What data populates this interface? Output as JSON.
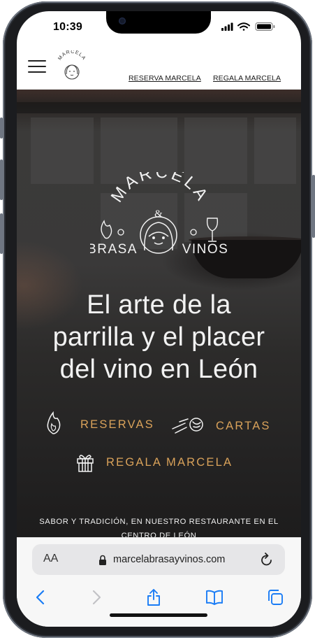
{
  "status_bar": {
    "time": "10:39",
    "signal_icon": "cellular-signal-icon",
    "wifi_icon": "wifi-icon",
    "battery_icon": "battery-icon"
  },
  "header": {
    "menu_icon": "hamburger-menu-icon",
    "logo_text": "MARCELA",
    "nav": [
      {
        "label": "RESERVA MARCELA"
      },
      {
        "label": "REGALA MARCELA"
      }
    ]
  },
  "hero": {
    "logo": {
      "name": "MARCELA",
      "ampersand": "&",
      "left": "BRASA",
      "right": "VINOS"
    },
    "headline": [
      "El arte de la",
      "parrilla y el placer",
      "del vino en León"
    ],
    "ctas": [
      {
        "label": "RESERVAS",
        "icon": "flame-icon"
      },
      {
        "label": "CARTAS",
        "icon": "meat-icon"
      },
      {
        "label": "REGALA MARCELA",
        "icon": "gift-icon"
      }
    ],
    "tagline": [
      "SABOR Y TRADICIÓN, EN NUESTRO RESTAURANTE EN EL",
      "CENTRO DE LEÓN"
    ],
    "accent_color": "#d9a25a"
  },
  "browser": {
    "text_size_label": "AA",
    "url": "marcelabrasayvinos.com",
    "toolbar": [
      {
        "icon": "back-icon"
      },
      {
        "icon": "forward-icon"
      },
      {
        "icon": "share-icon"
      },
      {
        "icon": "bookmarks-icon"
      },
      {
        "icon": "tabs-icon"
      }
    ],
    "tint_color": "#1a7cf5"
  }
}
